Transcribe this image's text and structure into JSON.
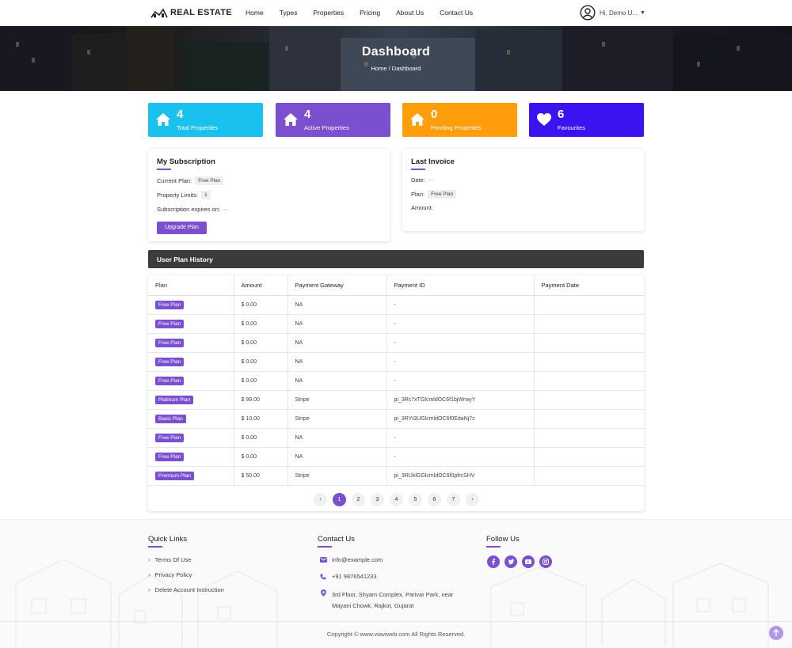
{
  "header": {
    "logo_text": "REAL ESTATE",
    "nav": [
      "Home",
      "Types",
      "Properties",
      "Pricing",
      "About Us",
      "Contact Us"
    ],
    "user_label": "Hi, Demo U...",
    "caret": "▼"
  },
  "hero": {
    "title": "Dashboard",
    "breadcrumb": "Home  /  Dashboard"
  },
  "stats": [
    {
      "value": "4",
      "label": "Total Properties",
      "color": "#1bc1ee",
      "icon": "home-icon"
    },
    {
      "value": "4",
      "label": "Active Properties",
      "color": "#7a4fd0",
      "icon": "home-icon"
    },
    {
      "value": "0",
      "label": "Pending Properties",
      "color": "#ff9d0a",
      "icon": "home-icon"
    },
    {
      "value": "6",
      "label": "Favourites",
      "color": "#3b12f0",
      "icon": "heart-icon"
    }
  ],
  "subscription": {
    "title": "My Subscription",
    "current_plan_label": "Current Plan:",
    "current_plan_value": "Free Plan",
    "limits_label": "Property Limits:",
    "limits_value": "1",
    "expires_label": "Subscription expires on:",
    "expires_value": "---",
    "upgrade_label": "Upgrade Plan"
  },
  "invoice": {
    "title": "Last Invoice",
    "date_label": "Date:",
    "date_value": "---",
    "plan_label": "Plan:",
    "plan_value": "Free Plan",
    "amount_label": "Amount:"
  },
  "history": {
    "title": "User Plan History",
    "columns": [
      "Plan",
      "Amount",
      "Payment Gateway",
      "Payment ID",
      "Payment Date"
    ],
    "rows": [
      {
        "plan": "Free Plan",
        "amount": "$ 0.00",
        "gateway": "NA",
        "payment_id": "-",
        "date": ""
      },
      {
        "plan": "Free Plan",
        "amount": "$ 0.00",
        "gateway": "NA",
        "payment_id": "-",
        "date": ""
      },
      {
        "plan": "Free Plan",
        "amount": "$ 0.00",
        "gateway": "NA",
        "payment_id": "-",
        "date": ""
      },
      {
        "plan": "Free Plan",
        "amount": "$ 0.00",
        "gateway": "NA",
        "payment_id": "-",
        "date": ""
      },
      {
        "plan": "Free Plan",
        "amount": "$ 0.00",
        "gateway": "NA",
        "payment_id": "-",
        "date": ""
      },
      {
        "plan": "Platinum Plan",
        "amount": "$ 99.00",
        "gateway": "Stripe",
        "payment_id": "pi_3Rc7xTGlcmldOC6f1bjWrwyY",
        "date": ""
      },
      {
        "plan": "Basic Plan",
        "amount": "$ 10.00",
        "gateway": "Stripe",
        "payment_id": "pi_3RYt3UGlcmldOC6f0EdaNj7c",
        "date": ""
      },
      {
        "plan": "Free Plan",
        "amount": "$ 0.00",
        "gateway": "NA",
        "payment_id": "-",
        "date": ""
      },
      {
        "plan": "Free Plan",
        "amount": "$ 0.00",
        "gateway": "NA",
        "payment_id": "-",
        "date": ""
      },
      {
        "plan": "Premium Plan",
        "amount": "$ 50.00",
        "gateway": "Stripe",
        "payment_id": "pi_3RUklGGlcmldOC6f0pfrcSHV",
        "date": ""
      }
    ],
    "pagination": {
      "prev": "‹",
      "next": "›",
      "pages": [
        "1",
        "2",
        "3",
        "4",
        "5",
        "6",
        "7"
      ],
      "active": "1"
    }
  },
  "footer": {
    "quick_links_title": "Quick Links",
    "quick_links": [
      "Terms Of Use",
      "Privacy Policy",
      "Delete Account Instruction"
    ],
    "contact_title": "Contact Us",
    "email": "info@example.com",
    "phone": "+91 9876541233",
    "address_line1": "3rd Floor, Shyam Complex, Parivar Park, near",
    "address_line2": "Mayani Chowk, Rajkot, Gujarat",
    "follow_title": "Follow Us",
    "social": [
      "facebook-icon",
      "twitter-icon",
      "youtube-icon",
      "instagram-icon"
    ],
    "copyright": "Copyright © www.viaviweb.com All Rights Reserved."
  },
  "colors": {
    "accent": "#7a4fd0",
    "dark_bar": "#3b3b3b"
  }
}
